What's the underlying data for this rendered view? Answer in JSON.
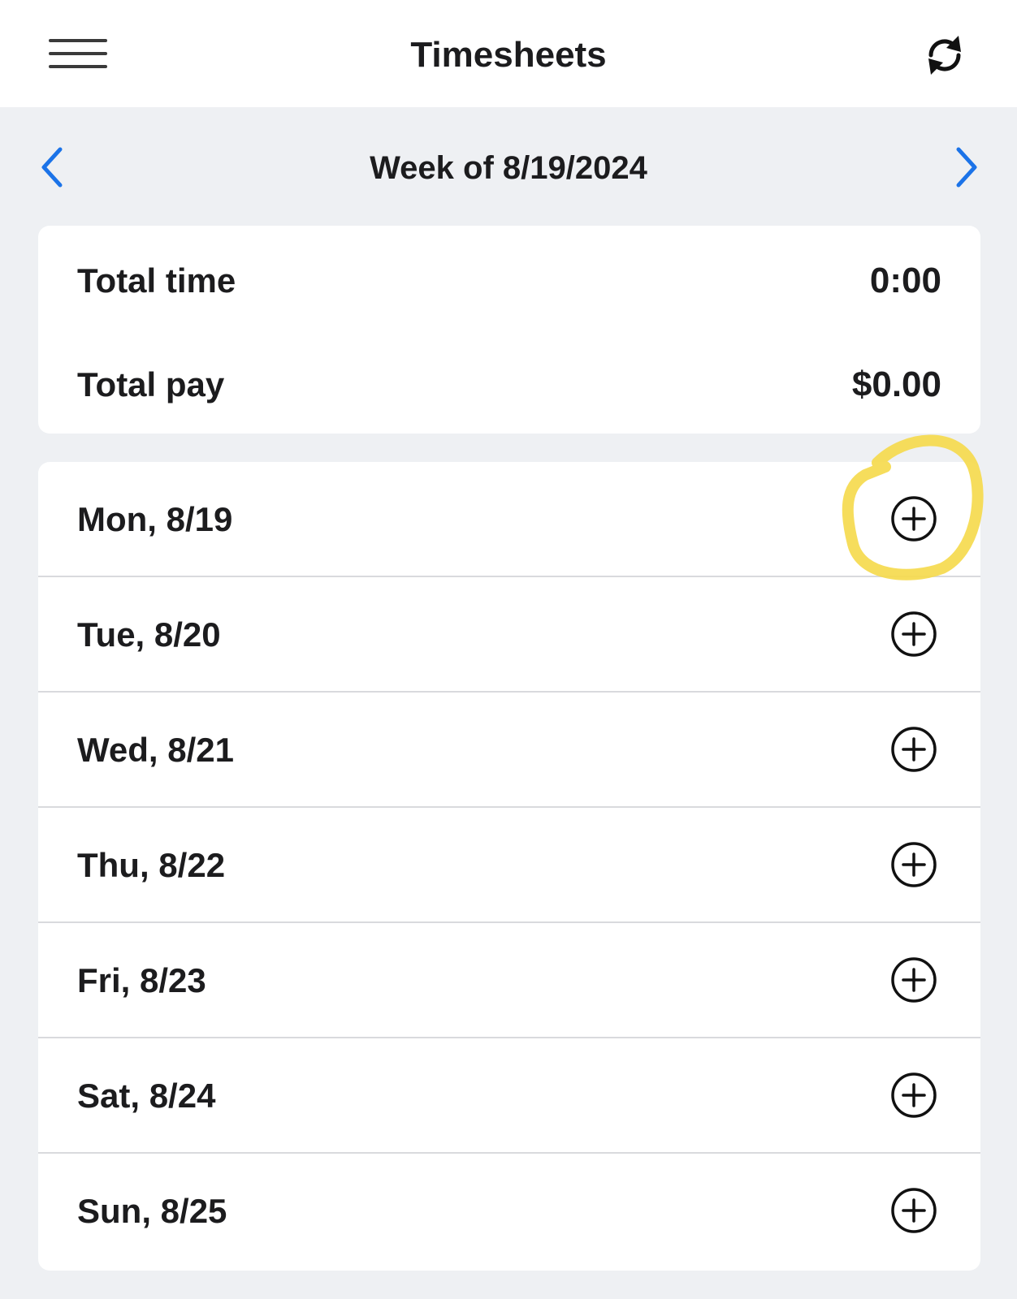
{
  "header": {
    "title": "Timesheets",
    "menu_icon": "hamburger-menu-icon",
    "refresh_icon": "refresh-icon"
  },
  "week_nav": {
    "label": "Week of 8/19/2024",
    "prev_icon": "chevron-left-icon",
    "next_icon": "chevron-right-icon",
    "accent_color": "#1b73e8"
  },
  "totals": {
    "time_label": "Total time",
    "time_value": "0:00",
    "pay_label": "Total pay",
    "pay_value": "$0.00"
  },
  "days": [
    {
      "label": "Mon, 8/19",
      "icon": "add-circle-icon"
    },
    {
      "label": "Tue, 8/20",
      "icon": "add-circle-icon"
    },
    {
      "label": "Wed, 8/21",
      "icon": "add-circle-icon"
    },
    {
      "label": "Thu, 8/22",
      "icon": "add-circle-icon"
    },
    {
      "label": "Fri, 8/23",
      "icon": "add-circle-icon"
    },
    {
      "label": "Sat, 8/24",
      "icon": "add-circle-icon"
    },
    {
      "label": "Sun, 8/25",
      "icon": "add-circle-icon"
    }
  ],
  "annotation": {
    "icon": "yellow-circle-annotation",
    "color": "#f5d94a"
  }
}
